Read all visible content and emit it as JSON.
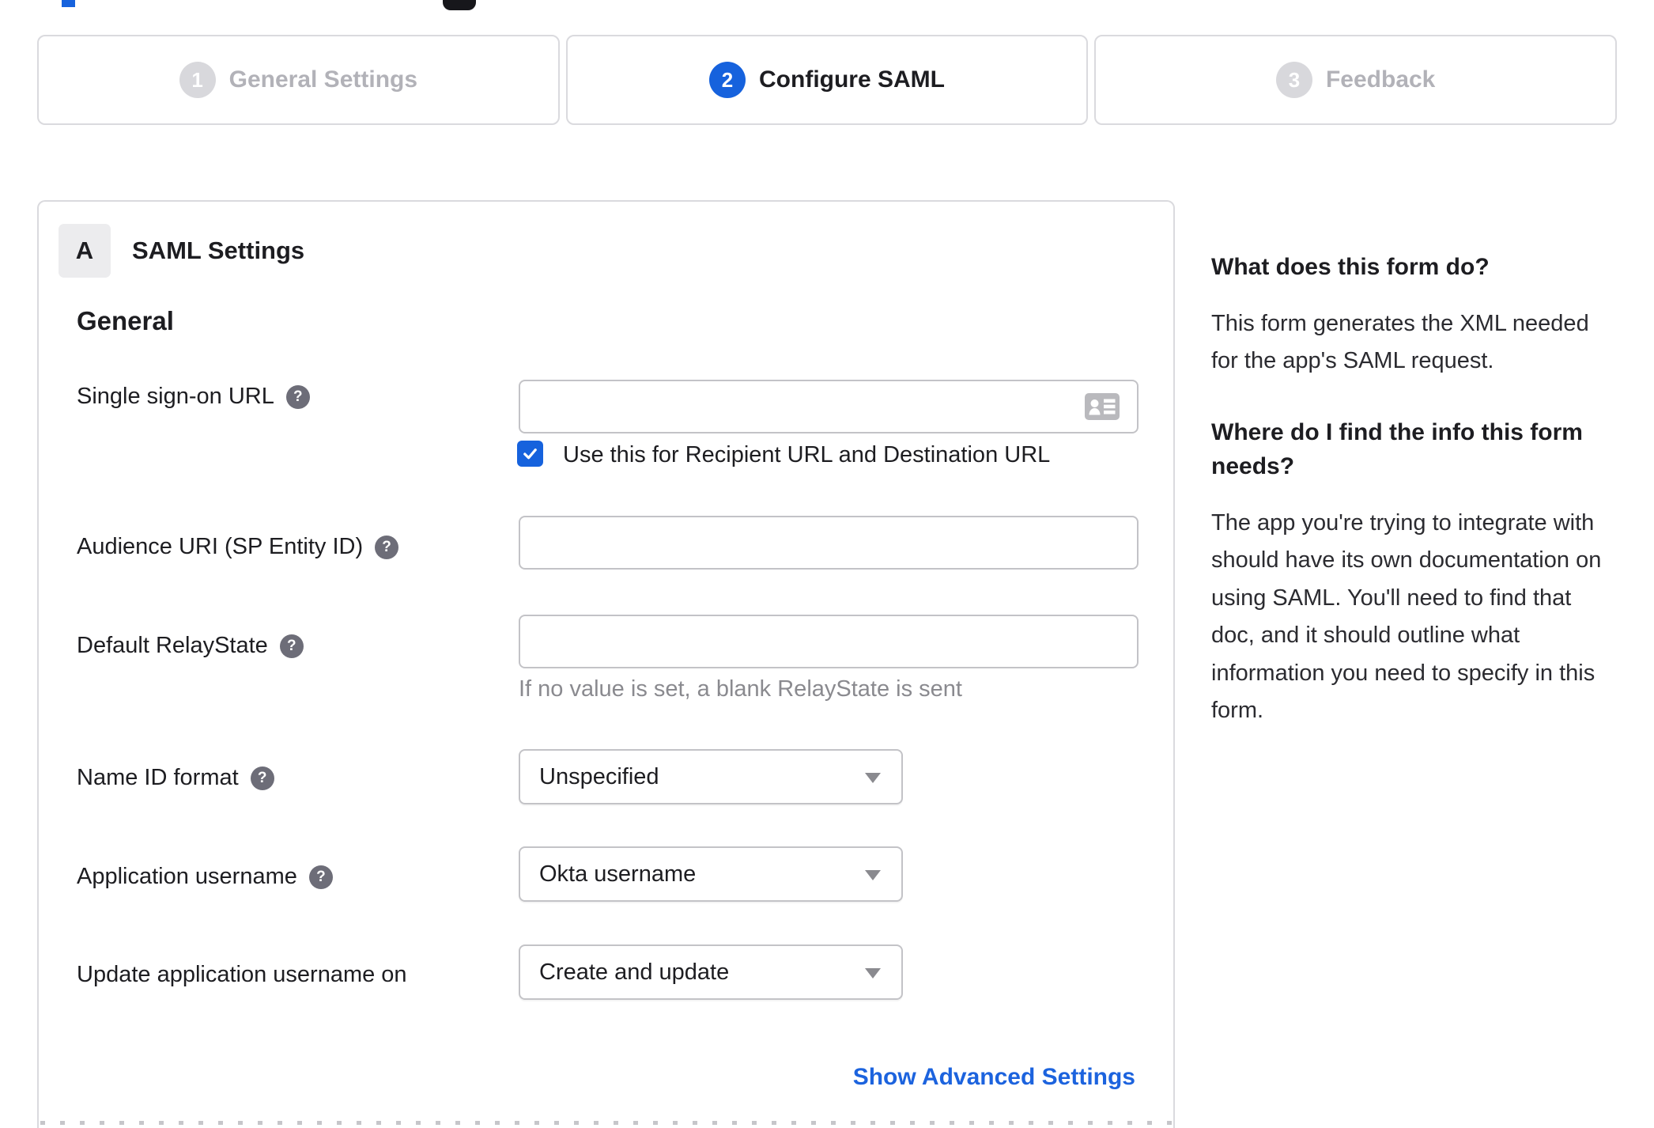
{
  "stepper": {
    "steps": [
      {
        "number": "1",
        "label": "General Settings",
        "state": "inactive"
      },
      {
        "number": "2",
        "label": "Configure SAML",
        "state": "active"
      },
      {
        "number": "3",
        "label": "Feedback",
        "state": "inactive"
      }
    ]
  },
  "panel": {
    "badge": "A",
    "section_title": "SAML Settings",
    "group_title": "General",
    "fields": [
      {
        "label": "Single sign-on URL",
        "type": "text",
        "value": "",
        "checkbox": {
          "checked": true,
          "label": "Use this for Recipient URL and Destination URL"
        }
      },
      {
        "label": "Audience URI (SP Entity ID)",
        "type": "text",
        "value": ""
      },
      {
        "label": "Default RelayState",
        "type": "text",
        "value": "",
        "hint": "If no value is set, a blank RelayState is sent"
      },
      {
        "label": "Name ID format",
        "type": "select",
        "value": "Unspecified"
      },
      {
        "label": "Application username",
        "type": "select",
        "value": "Okta username"
      },
      {
        "label": "Update application username on",
        "type": "select",
        "value": "Create and update"
      }
    ],
    "advanced_link": "Show Advanced Settings"
  },
  "sidebar": {
    "sections": [
      {
        "heading": "What does this form do?",
        "body": "This form generates the XML needed for the app's SAML request."
      },
      {
        "heading": "Where do I find the info this form needs?",
        "body": "The app you're trying to integrate with should have its own documentation on using SAML. You'll need to find that doc, and it should outline what information you need to specify in this form."
      }
    ]
  },
  "colors": {
    "accent_blue": "#1662dd",
    "link_blue": "#1c63de",
    "inactive_gray": "#d8d8dc",
    "border_gray": "#c3c3c7",
    "help_icon_gray": "#6d6d78"
  }
}
